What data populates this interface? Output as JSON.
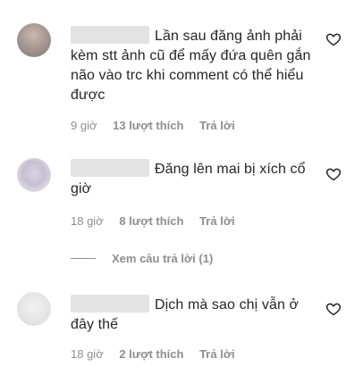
{
  "comments": [
    {
      "text": "Lần sau đăng ảnh phải kèm stt ảnh cũ để mấy đứa quên gắn não vào trc khi comment có thể hiểu được",
      "time": "9 giờ",
      "likes": "13 lượt thích",
      "reply": "Trả lời"
    },
    {
      "text": "Đăng lên mai bị xích cổ giờ",
      "time": "18 giờ",
      "likes": "8 lượt thích",
      "reply": "Trả lời"
    },
    {
      "text": "Dịch mà sao chị vẫn ở đây thế",
      "time": "18 giờ",
      "likes": "2 lượt thích",
      "reply": "Trả lời"
    }
  ],
  "view_replies": "Xem câu trả lời (1)",
  "icons": {
    "like": "heart-outline-icon"
  }
}
